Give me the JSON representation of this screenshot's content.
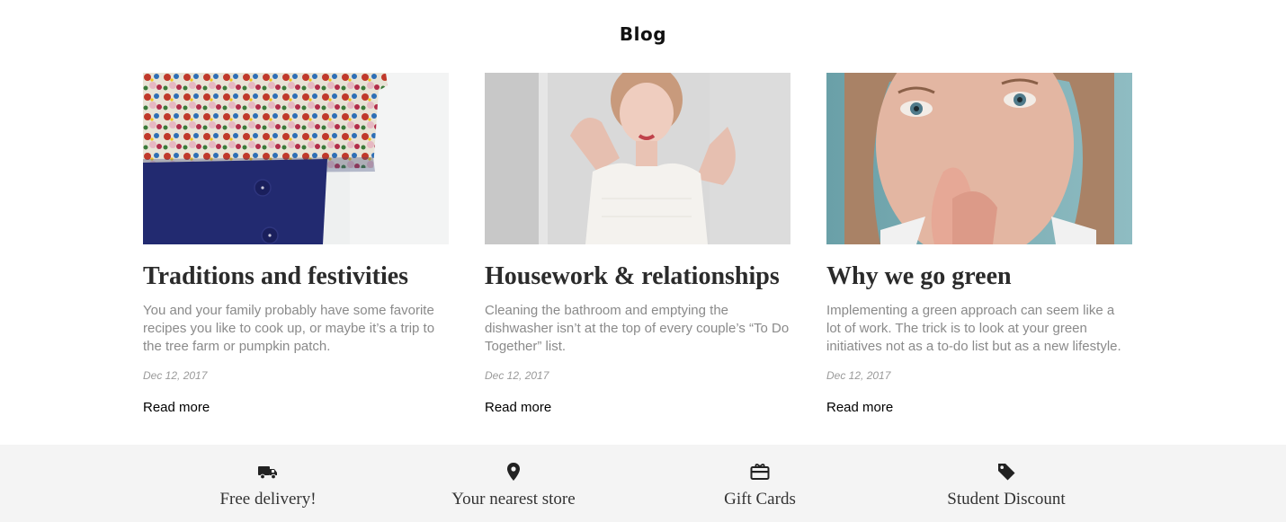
{
  "page": {
    "heading": "Blog"
  },
  "posts": [
    {
      "title": "Traditions and festivities",
      "excerpt": "You and your family probably have some favorite recipes you like to cook up, or maybe it’s a trip to the tree farm or pumpkin patch.",
      "date": "Dec 12, 2017",
      "link_label": "Read more",
      "image": "floral-blouse-navy-skirt-photo"
    },
    {
      "title": "Housework & relationships",
      "excerpt": "Cleaning the bathroom and emptying the dishwasher isn’t at the top of every couple’s “To Do Together” list.",
      "date": "Dec 12, 2017",
      "link_label": "Read more",
      "image": "woman-white-top-photo"
    },
    {
      "title": "Why we go green",
      "excerpt": "Implementing a green approach can seem like a lot of work. The trick is to look at your green initiatives not as a to-do list but as a new lifestyle.",
      "date": "Dec 12, 2017",
      "link_label": "Read more",
      "image": "woman-portrait-teal-photo"
    }
  ],
  "features": [
    {
      "label": "Free delivery!",
      "icon": "truck-icon"
    },
    {
      "label": "Your nearest store",
      "icon": "map-pin-icon"
    },
    {
      "label": "Gift Cards",
      "icon": "gift-card-icon"
    },
    {
      "label": "Student Discount",
      "icon": "tag-icon"
    }
  ],
  "colors": {
    "text_muted": "#8a8a8a",
    "features_bg": "#f4f4f4",
    "title": "#2b2b2b"
  }
}
